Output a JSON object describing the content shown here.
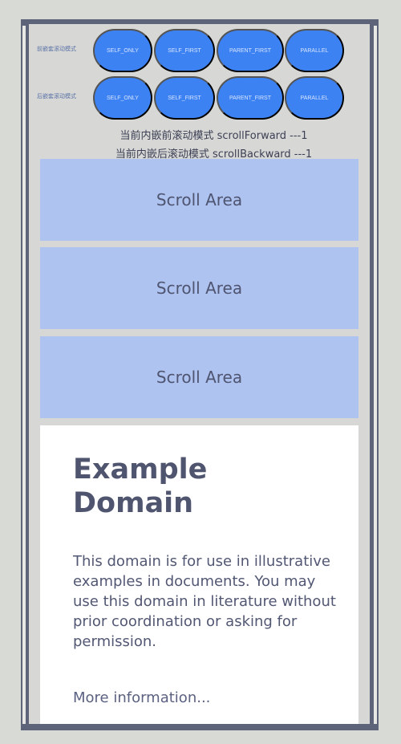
{
  "controls": {
    "rows": [
      {
        "label": "前嵌套滚动模式",
        "buttons": [
          "SELF_ONLY",
          "SELF_FIRST",
          "PARENT_FIRST",
          "PARALLEL"
        ]
      },
      {
        "label": "后嵌套滚动模式",
        "buttons": [
          "SELF_ONLY",
          "SELF_FIRST",
          "PARENT_FIRST",
          "PARALLEL"
        ]
      }
    ],
    "status_forward": "当前内嵌前滚动模式 scrollForward ---1",
    "status_backward": "当前内嵌后滚动模式  scrollBackward ---1"
  },
  "scroll_areas": [
    "Scroll Area",
    "Scroll Area",
    "Scroll Area"
  ],
  "web": {
    "title": "Example Domain",
    "body": "This domain is for use in illustrative examples in documents. You may use this domain in literature without prior coordination or asking for permission.",
    "link": "More information..."
  },
  "colors": {
    "frame": "#5d6378",
    "button": "#3d82f3",
    "scroll_area": "#aec3f0",
    "web_background": "#ffffff"
  }
}
